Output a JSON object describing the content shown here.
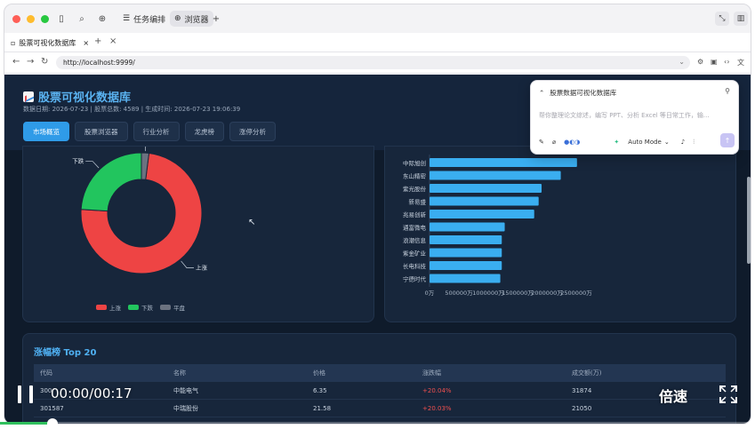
{
  "browser": {
    "tabs_top": [
      {
        "label": "任务编排",
        "active": false
      },
      {
        "label": "浏览器",
        "active": true
      }
    ],
    "page_tab": "股票可视化数据库",
    "url": "http://localhost:9999/"
  },
  "app": {
    "title": "股票可视化数据库",
    "subtitle": "数据日期: 2026-07-23 | 股票总数: 4589 | 生成时间: 2026-07-23 19:06:39",
    "tabs": [
      {
        "label": "市场概览",
        "active": true
      },
      {
        "label": "股票浏览器",
        "active": false
      },
      {
        "label": "行业分析",
        "active": false
      },
      {
        "label": "龙虎榜",
        "active": false
      },
      {
        "label": "涨停分析",
        "active": false
      }
    ]
  },
  "chart_data": [
    {
      "type": "pie",
      "labels": [
        "上涨",
        "下跌",
        "平盘"
      ],
      "values": [
        74,
        24,
        2
      ],
      "colors": [
        "#ee4444",
        "#22c55e",
        "#6b7280"
      ],
      "slice_labels": [
        "上涨",
        "下跌",
        "平盘"
      ],
      "legend": [
        "上涨",
        "下跌",
        "平盘"
      ]
    },
    {
      "type": "bar",
      "orientation": "horizontal",
      "categories": [
        "中际旭创",
        "东山精密",
        "紫光股份",
        "新易盛",
        "兆易创新",
        "通富微电",
        "浪潮信息",
        "紫金矿业",
        "长电科技",
        "宁德时代"
      ],
      "values": [
        1000000,
        890000,
        760000,
        740000,
        710000,
        510000,
        490000,
        490000,
        490000,
        480000
      ],
      "x_ticks": [
        "0万",
        "500000万",
        "1000000万",
        "1500000万",
        "2000000万",
        "2500000万"
      ],
      "color": "#3aaef0"
    }
  ],
  "top20": {
    "title": "涨幅榜 Top 20",
    "headers": [
      "代码",
      "名称",
      "价格",
      "涨跌幅",
      "成交额(万)"
    ],
    "rows": [
      [
        "300",
        "中能电气",
        "6.35",
        "+20.04%",
        "31874"
      ],
      [
        "301587",
        "中瑞股份",
        "21.58",
        "+20.03%",
        "21050"
      ]
    ]
  },
  "ai": {
    "title": "股票数据可视化数据库",
    "placeholder": "帮你整理论文综述，编写 PPT、分析 Excel 等日常工作，输...",
    "mode": "Auto Mode"
  },
  "video": {
    "time": "00:00/00:17",
    "speed": "倍速",
    "progress": 0.07
  }
}
